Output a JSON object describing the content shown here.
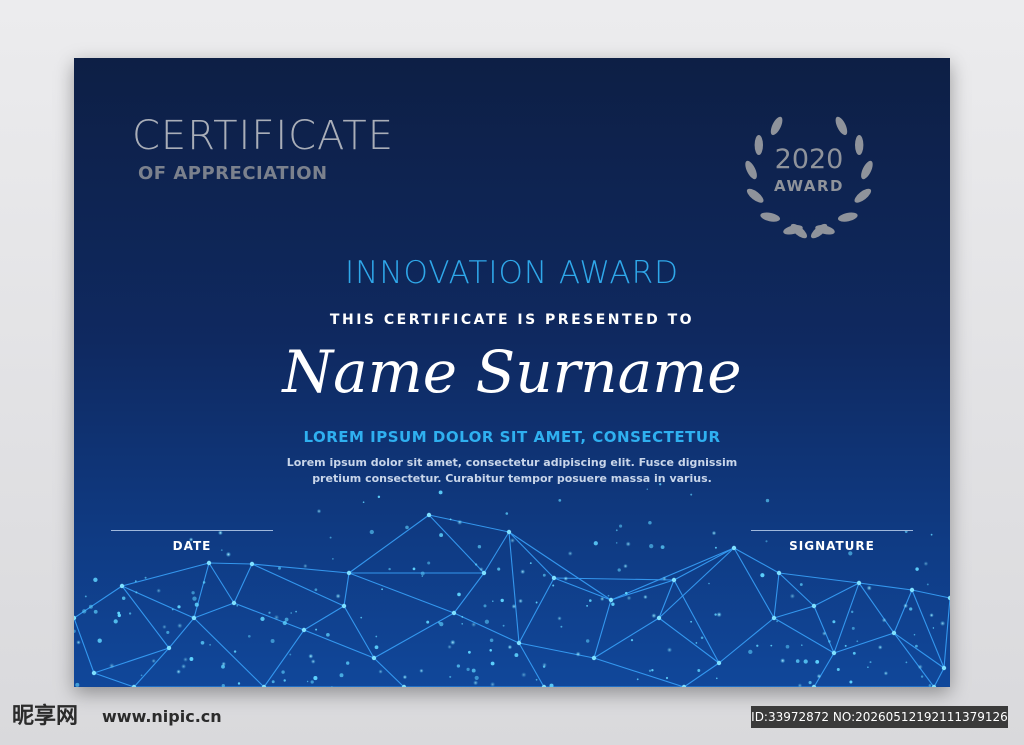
{
  "certificate": {
    "title": "CERTIFICATE",
    "subtitle": "OF APPRECIATION",
    "seal": {
      "year": "2020",
      "label": "AWARD",
      "icon": "laurel-wreath-icon",
      "color": "#8f939b"
    },
    "award_name": "INNOVATION AWARD",
    "presented_line": "THIS CERTIFICATE IS PRESENTED TO",
    "recipient_name": "Name Surname",
    "lead_line": "LOREM IPSUM DOLOR SIT AMET, CONSECTETUR",
    "body_line_1": "Lorem ipsum dolor sit amet, consectetur adipiscing elit. Fusce dignissim",
    "body_line_2": "pretium consectetur. Curabitur tempor posuere massa in varius.",
    "date_label": "DATE",
    "signature_label": "SIGNATURE",
    "colors": {
      "background_top": "#0d1f45",
      "background_bottom": "#10479a",
      "accent_blue": "#2fa8ea",
      "network_line": "#3aa6ff",
      "title_gray": "#a9aeb8"
    }
  },
  "watermark": {
    "logo_text": "昵享网",
    "url": "www.nipic.cn",
    "id_text": "ID:33972872 NO:20260512192111379126"
  }
}
